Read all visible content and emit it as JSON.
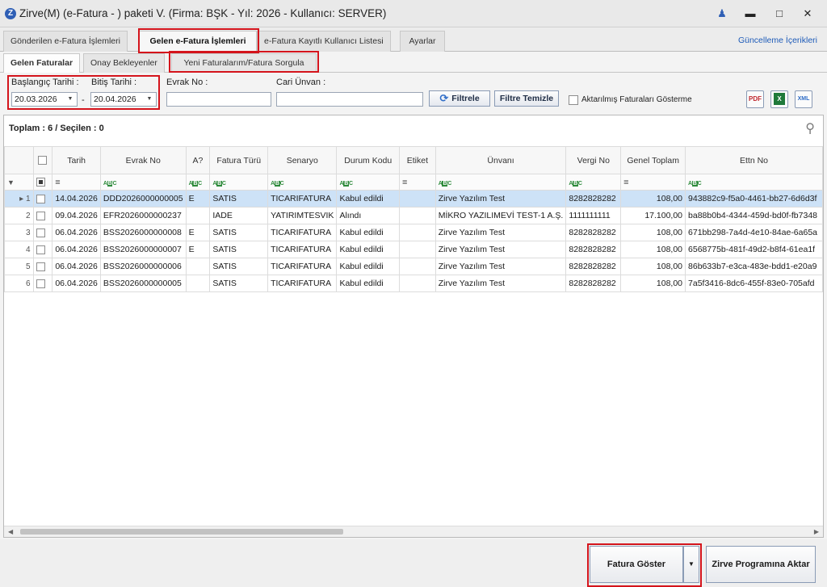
{
  "window": {
    "title": "Zirve(M)  (e-Fatura - ) paketi V. (Firma: BŞK - Yıl: 2026 - Kullanıcı: SERVER)"
  },
  "main_tabs": [
    {
      "label": "Gönderilen e-Fatura İşlemleri"
    },
    {
      "label": "Gelen e-Fatura İşlemleri"
    },
    {
      "label": "e-Fatura Kayıtlı Kullanıcı Listesi"
    },
    {
      "label": "Ayarlar"
    }
  ],
  "update_link": "Güncelleme İçerikleri",
  "sub_tabs": [
    {
      "label": "Gelen Faturalar"
    },
    {
      "label": "Onay Bekleyenler"
    },
    {
      "label": "Yeni Faturalarım/Fatura Sorgula"
    }
  ],
  "filters": {
    "start_label": "Başlangıç Tarihi :",
    "start_value": "20.03.2026",
    "separator": "-",
    "end_label": "Bitiş Tarihi :",
    "end_value": "20.04.2026",
    "evrak_label": "Evrak No :",
    "evrak_value": "",
    "cari_label": "Cari Ünvan :",
    "cari_value": "",
    "filter_button": "Filtrele",
    "clear_button": "Filtre Temizle",
    "show_transferred_label": "Aktarılmış Faturaları Gösterme"
  },
  "export": {
    "pdf": "PDF",
    "excel": "X",
    "xml": "XML"
  },
  "summary": "Toplam : 6 / Seçilen : 0",
  "columns": [
    "Tarih",
    "Evrak No",
    "A?",
    "Fatura Türü",
    "Senaryo",
    "Durum Kodu",
    "Etiket",
    "Ünvanı",
    "Vergi No",
    "Genel Toplam",
    "Ettn No"
  ],
  "filter_row": [
    "=",
    "ABC",
    "ABC",
    "ABC",
    "ABC",
    "ABC",
    "=",
    "ABC",
    "ABC",
    "=",
    "ABC"
  ],
  "rows": [
    {
      "no": "1",
      "tarih": "14.04.2026",
      "evrak": "DDD2026000000005",
      "a": "E",
      "tur": "SATIS",
      "senaryo": "TICARIFATURA",
      "durum": "Kabul edildi",
      "etiket": "",
      "unvan": "Zirve Yazılım Test",
      "vergi": "8282828282",
      "toplam": "108,00",
      "ettn": "943882c9-f5a0-4461-bb27-6d6d3f"
    },
    {
      "no": "2",
      "tarih": "09.04.2026",
      "evrak": "EFR2026000000237",
      "a": "",
      "tur": "IADE",
      "senaryo": "YATIRIMTESVIK",
      "durum": "Alındı",
      "etiket": "",
      "unvan": "MİKRO YAZILIMEVİ TEST-1 A.Ş.",
      "vergi": "1111111111",
      "toplam": "17.100,00",
      "ettn": "ba88b0b4-4344-459d-bd0f-fb7348"
    },
    {
      "no": "3",
      "tarih": "06.04.2026",
      "evrak": "BSS2026000000008",
      "a": "E",
      "tur": "SATIS",
      "senaryo": "TICARIFATURA",
      "durum": "Kabul edildi",
      "etiket": "",
      "unvan": "Zirve Yazılım Test",
      "vergi": "8282828282",
      "toplam": "108,00",
      "ettn": "671bb298-7a4d-4e10-84ae-6a65a"
    },
    {
      "no": "4",
      "tarih": "06.04.2026",
      "evrak": "BSS2026000000007",
      "a": "E",
      "tur": "SATIS",
      "senaryo": "TICARIFATURA",
      "durum": "Kabul edildi",
      "etiket": "",
      "unvan": "Zirve Yazılım Test",
      "vergi": "8282828282",
      "toplam": "108,00",
      "ettn": "6568775b-481f-49d2-b8f4-61ea1f"
    },
    {
      "no": "5",
      "tarih": "06.04.2026",
      "evrak": "BSS2026000000006",
      "a": "",
      "tur": "SATIS",
      "senaryo": "TICARIFATURA",
      "durum": "Kabul edildi",
      "etiket": "",
      "unvan": "Zirve Yazılım Test",
      "vergi": "8282828282",
      "toplam": "108,00",
      "ettn": "86b633b7-e3ca-483e-bdd1-e20a9"
    },
    {
      "no": "6",
      "tarih": "06.04.2026",
      "evrak": "BSS2026000000005",
      "a": "",
      "tur": "SATIS",
      "senaryo": "TICARIFATURA",
      "durum": "Kabul edildi",
      "etiket": "",
      "unvan": "Zirve Yazılım Test",
      "vergi": "8282828282",
      "toplam": "108,00",
      "ettn": "7a5f3416-8dc6-455f-83e0-705afd"
    }
  ],
  "bottom": {
    "show_invoice": "Fatura Göster",
    "transfer": "Zirve Programına Aktar"
  },
  "colors": {
    "highlight": "#d4141c",
    "selected_row": "#cde2f7",
    "accent": "#2f5fb5"
  }
}
